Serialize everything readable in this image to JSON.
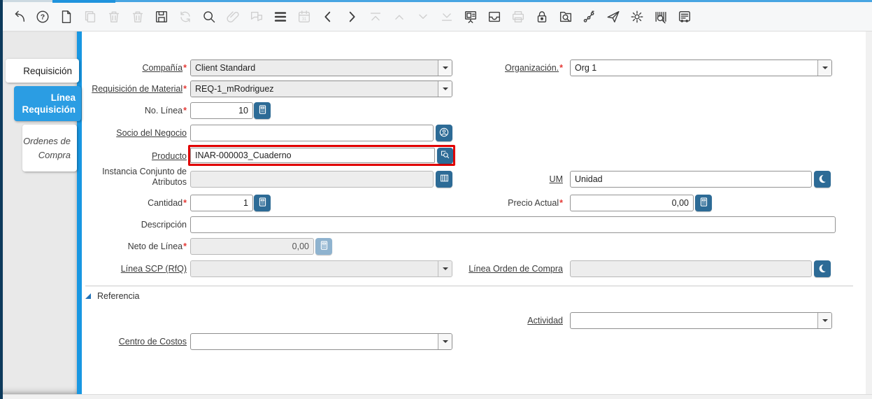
{
  "tabs": [
    {
      "label": "Requisición"
    },
    {
      "label": "Línea Requisición"
    },
    {
      "label": "Ordenes de Compra"
    }
  ],
  "toolbar": {
    "icons": [
      {
        "name": "ignore-changes",
        "enabled": true
      },
      {
        "name": "help",
        "enabled": true
      },
      {
        "name": "new-record",
        "enabled": true
      },
      {
        "name": "copy-record",
        "enabled": false
      },
      {
        "name": "delete-record",
        "enabled": false
      },
      {
        "name": "delete-selection",
        "enabled": false
      },
      {
        "name": "save",
        "enabled": true
      },
      {
        "name": "requery",
        "enabled": false
      },
      {
        "name": "find",
        "enabled": true
      },
      {
        "name": "attachment",
        "enabled": false
      },
      {
        "name": "chat",
        "enabled": false
      },
      {
        "name": "grid-toggle",
        "enabled": true
      },
      {
        "name": "history",
        "enabled": false
      },
      {
        "name": "parent-record",
        "enabled": true
      },
      {
        "name": "detail-record",
        "enabled": true
      },
      {
        "name": "first-record",
        "enabled": false
      },
      {
        "name": "previous-record",
        "enabled": false
      },
      {
        "name": "next-record",
        "enabled": false
      },
      {
        "name": "last-record",
        "enabled": false
      },
      {
        "name": "form",
        "enabled": true
      },
      {
        "name": "archive",
        "enabled": true
      },
      {
        "name": "print",
        "enabled": false
      },
      {
        "name": "lock",
        "enabled": true
      },
      {
        "name": "zoom-across",
        "enabled": true
      },
      {
        "name": "workflow",
        "enabled": true
      },
      {
        "name": "send",
        "enabled": true
      },
      {
        "name": "process",
        "enabled": true
      },
      {
        "name": "product-info",
        "enabled": true
      },
      {
        "name": "report",
        "enabled": true
      }
    ]
  },
  "form": {
    "compania": {
      "label": "Compañía",
      "value": "Client Standard"
    },
    "organizacion": {
      "label": "Organización.",
      "value": "Org 1"
    },
    "requisicion_material": {
      "label": "Requisición de Material",
      "value": "REQ-1_mRodriguez"
    },
    "no_linea": {
      "label": "No. Línea",
      "value": "10"
    },
    "socio_negocio": {
      "label": "Socio del Negocio",
      "value": ""
    },
    "producto": {
      "label": "Producto",
      "value": "INAR-000003_Cuaderno"
    },
    "instancia_atributos": {
      "label": "Instancia Conjunto de Atributos",
      "value": ""
    },
    "um": {
      "label": "UM",
      "value": "Unidad"
    },
    "cantidad": {
      "label": "Cantidad",
      "value": "1"
    },
    "precio_actual": {
      "label": "Precio Actual",
      "value": "0,00"
    },
    "descripcion": {
      "label": "Descripción",
      "value": ""
    },
    "neto_linea": {
      "label": "Neto de Línea",
      "value": "0,00"
    },
    "linea_scp": {
      "label": "Línea SCP (RfQ)",
      "value": ""
    },
    "linea_oc": {
      "label": "Línea Orden de Compra",
      "value": ""
    },
    "actividad": {
      "label": "Actividad",
      "value": ""
    },
    "centro_costos": {
      "label": "Centro de Costos",
      "value": ""
    },
    "section_referencia": "Referencia"
  },
  "colors": {
    "active_tab_blue": "#2b9de3",
    "divider_blue": "#1897e2",
    "assist_button_blue": "#2d6b96",
    "window_navy": "#0d3a5c",
    "required_red": "#e53935",
    "focus_border_red": "#e10000"
  }
}
